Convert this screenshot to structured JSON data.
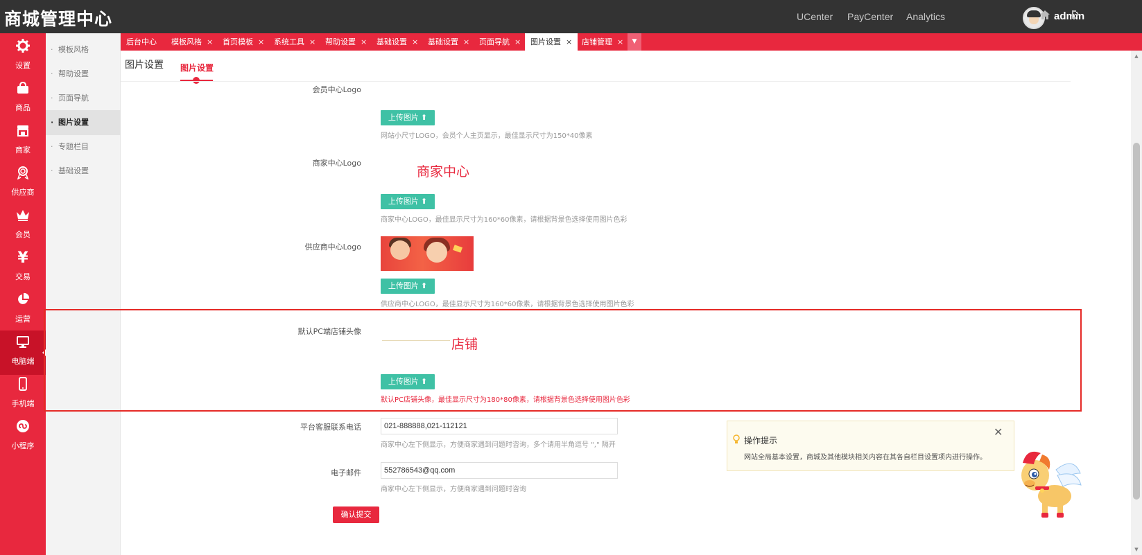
{
  "app": {
    "title": "商城管理中心",
    "top_links": [
      "UCenter",
      "PayCenter",
      "Analytics"
    ],
    "user_name": "admin"
  },
  "sidebar": {
    "items": [
      {
        "label": "设置",
        "icon": "gear-icon"
      },
      {
        "label": "商品",
        "icon": "shopping-bag-icon"
      },
      {
        "label": "商家",
        "icon": "store-icon"
      },
      {
        "label": "供应商",
        "icon": "medal-icon"
      },
      {
        "label": "会员",
        "icon": "crown-icon"
      },
      {
        "label": "交易",
        "icon": "yen-icon"
      },
      {
        "label": "运营",
        "icon": "pie-chart-icon"
      },
      {
        "label": "电脑端",
        "icon": "monitor-icon"
      },
      {
        "label": "手机端",
        "icon": "mobile-icon"
      },
      {
        "label": "小程序",
        "icon": "miniprogram-icon"
      }
    ],
    "active": "电脑端"
  },
  "subnav": {
    "items": [
      "模板风格",
      "帮助设置",
      "页面导航",
      "图片设置",
      "专题栏目",
      "基础设置"
    ],
    "active": "图片设置"
  },
  "tabs": {
    "items": [
      "后台中心",
      "模板风格",
      "首页模板",
      "系统工具",
      "帮助设置",
      "基础设置",
      "基础设置",
      "页面导航",
      "图片设置",
      "店铺管理"
    ],
    "active": "图片设置",
    "close_symbol": "×",
    "more_symbol": "▼"
  },
  "page": {
    "title": "图片设置",
    "sub_tab": "图片设置"
  },
  "form": {
    "upload_label": "上传图片",
    "upload_symbol": "⬆",
    "member_logo": {
      "label": "会员中心Logo",
      "hint": "网站小尺寸LOGO，会员个人主页显示，最佳显示尺寸为150*40像素"
    },
    "seller_logo": {
      "label": "商家中心Logo",
      "image_text": "商家中心",
      "hint": "商家中心LOGO，最佳显示尺寸为160*60像素，请根据背景色选择使用图片色彩"
    },
    "supplier_logo": {
      "label": "供应商中心Logo",
      "hint": "供应商中心LOGO，最佳显示尺寸为160*60像素，请根据背景色选择使用图片色彩"
    },
    "shop_avatar": {
      "label": "默认PC端店铺头像",
      "image_text": "店铺",
      "hint": "默认PC店铺头像，最佳显示尺寸为180*80像素，请根据背景色选择使用图片色彩"
    },
    "phone": {
      "label": "平台客服联系电话",
      "value": "021-888888,021-112121",
      "hint": "商家中心左下侧显示，方便商家遇到问题时咨询，多个请用半角逗号 \",\" 隔开"
    },
    "email": {
      "label": "电子邮件",
      "value": "552786543@qq.com",
      "hint": "商家中心左下侧显示，方便商家遇到问题时咨询"
    },
    "submit_label": "确认提交"
  },
  "tip": {
    "title": "操作提示",
    "text": "网站全局基本设置，商城及其他模块相关内容在其各自栏目设置项内进行操作。",
    "close_symbol": "✕"
  },
  "colors": {
    "brand_red": "#e8283e",
    "upload_green": "#3fc1a5",
    "topbar": "#333333"
  }
}
